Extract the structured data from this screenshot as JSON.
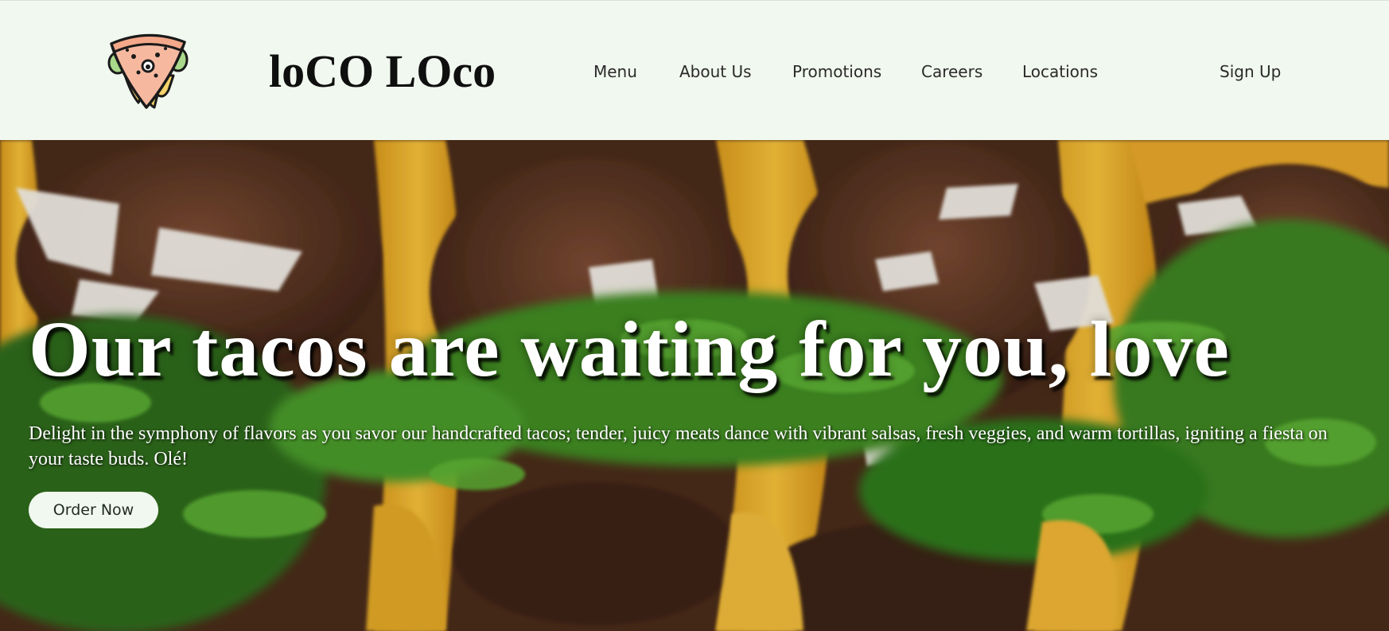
{
  "brand": {
    "name": "loCO LOco",
    "logo_icon": "taco-slice-mascot-icon"
  },
  "nav": {
    "menu": "Menu",
    "about": "About Us",
    "promotions": "Promotions",
    "careers": "Careers",
    "locations": "Locations",
    "signup": "Sign Up"
  },
  "hero": {
    "title": "Our tacos are waiting for you, love",
    "text": "Delight in the symphony of flavors as you savor our handcrafted tacos; tender, juicy meats dance with vibrant salsas, fresh veggies, and warm tortillas, igniting a fiesta on your taste buds. Olé!",
    "cta": "Order Now",
    "image": "tacos-photo"
  },
  "colors": {
    "header_bg": "#f1f8ef",
    "button_bg": "#f1f8ef",
    "text_dark": "#0f0f0f",
    "hero_text": "#ffffff"
  }
}
